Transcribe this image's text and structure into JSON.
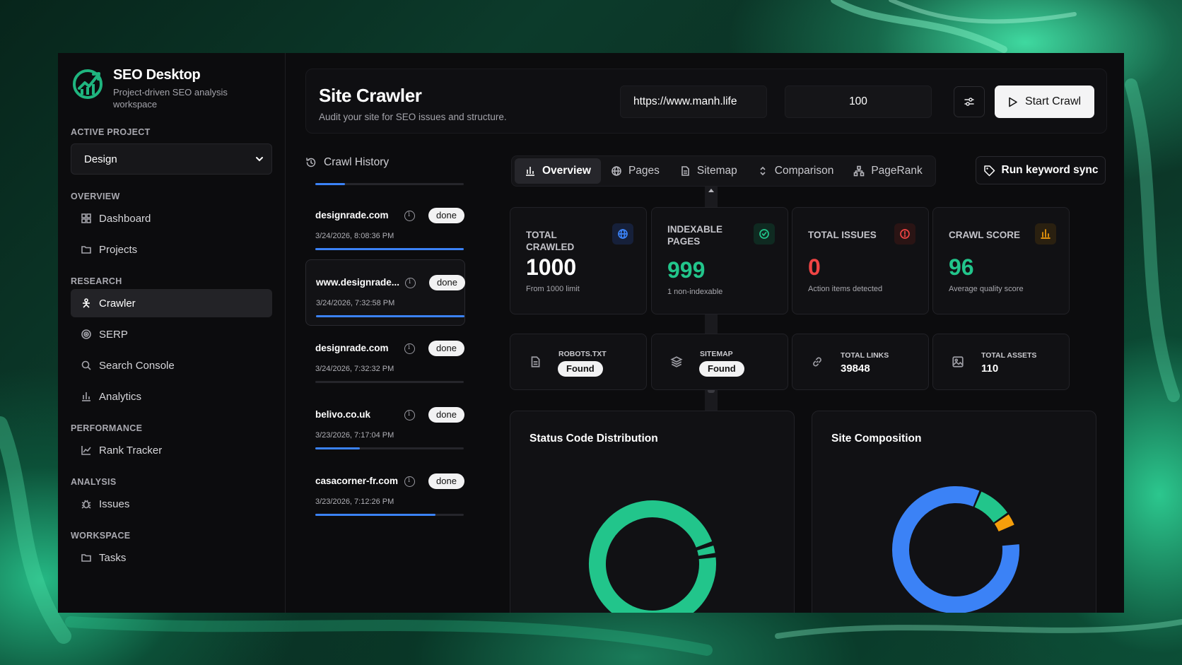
{
  "brand": {
    "title": "SEO Desktop",
    "subtitle": "Project-driven SEO analysis workspace"
  },
  "sidebar": {
    "active_project_label": "ACTIVE PROJECT",
    "project_value": "Design",
    "groups": [
      {
        "label": "OVERVIEW",
        "items": [
          {
            "label": "Dashboard",
            "icon": "grid-icon"
          },
          {
            "label": "Projects",
            "icon": "folder-icon"
          }
        ]
      },
      {
        "label": "RESEARCH",
        "items": [
          {
            "label": "Crawler",
            "icon": "crawler-icon",
            "active": true
          },
          {
            "label": "SERP",
            "icon": "target-icon"
          },
          {
            "label": "Search Console",
            "icon": "search-icon"
          },
          {
            "label": "Analytics",
            "icon": "bar-chart-icon"
          }
        ]
      },
      {
        "label": "PERFORMANCE",
        "items": [
          {
            "label": "Rank Tracker",
            "icon": "line-chart-icon"
          }
        ]
      },
      {
        "label": "ANALYSIS",
        "items": [
          {
            "label": "Issues",
            "icon": "bug-icon"
          }
        ]
      },
      {
        "label": "WORKSPACE",
        "items": [
          {
            "label": "Tasks",
            "icon": "folder-icon"
          }
        ]
      }
    ]
  },
  "header": {
    "title": "Site Crawler",
    "subtitle": "Audit your site for SEO issues and structure.",
    "url_value": "https://www.manh.life",
    "limit_value": "100",
    "start_label": "Start Crawl"
  },
  "history": {
    "title": "Crawl History",
    "items": [
      {
        "site": "",
        "date": "",
        "status": "",
        "progress": 0.2,
        "partial": true
      },
      {
        "site": "designrade.com",
        "date": "3/24/2026, 8:08:36 PM",
        "status": "done",
        "progress": 1.0
      },
      {
        "site": "www.designrade...",
        "date": "3/24/2026, 7:32:58 PM",
        "status": "done",
        "progress": 1.0,
        "selected": true
      },
      {
        "site": "designrade.com",
        "date": "3/24/2026, 7:32:32 PM",
        "status": "done",
        "progress": 0.0
      },
      {
        "site": "belivo.co.uk",
        "date": "3/23/2026, 7:17:04 PM",
        "status": "done",
        "progress": 0.3
      },
      {
        "site": "casacorner-fr.com",
        "date": "3/23/2026, 7:12:26 PM",
        "status": "done",
        "progress": 0.81
      }
    ]
  },
  "tabs": [
    {
      "label": "Overview",
      "icon": "bar-chart-icon",
      "active": true
    },
    {
      "label": "Pages",
      "icon": "globe-icon"
    },
    {
      "label": "Sitemap",
      "icon": "file-icon"
    },
    {
      "label": "Comparison",
      "icon": "chevrons-up-down-icon"
    },
    {
      "label": "PageRank",
      "icon": "network-icon"
    }
  ],
  "keyword_button": "Run keyword sync",
  "stats": [
    {
      "label": "TOTAL CRAWLED",
      "value": "1000",
      "note": "From 1000 limit",
      "color": "#ffffff",
      "icon_color": "#3b82f6",
      "icon_bg": "#16203a",
      "icon": "globe-icon"
    },
    {
      "label": "INDEXABLE PAGES",
      "value": "999",
      "note": "1 non-indexable",
      "color": "#22c58b",
      "icon_color": "#22c58b",
      "icon_bg": "#0f2a21",
      "icon": "check-circle-icon"
    },
    {
      "label": "TOTAL ISSUES",
      "value": "0",
      "note": "Action items detected",
      "color": "#ef4444",
      "icon_color": "#ef4444",
      "icon_bg": "#2a1414",
      "icon": "alert-circle-icon"
    },
    {
      "label": "CRAWL SCORE",
      "value": "96",
      "note": "Average quality score",
      "color": "#22c58b",
      "icon_color": "#f59e0b",
      "icon_bg": "#2a2010",
      "icon": "bar-chart-icon"
    }
  ],
  "mini": [
    {
      "label": "ROBOTS.TXT",
      "badge": "Found",
      "icon": "file-icon"
    },
    {
      "label": "SITEMAP",
      "badge": "Found",
      "icon": "layers-icon"
    },
    {
      "label": "TOTAL LINKS",
      "value": "39848",
      "icon": "link-icon"
    },
    {
      "label": "TOTAL ASSETS",
      "value": "110",
      "icon": "image-icon"
    }
  ],
  "charts": {
    "status": {
      "title": "Status Code Distribution"
    },
    "composition": {
      "title": "Site Composition"
    }
  },
  "chart_data": [
    {
      "type": "pie",
      "title": "Status Code Distribution",
      "slices": [
        {
          "value": 0.97,
          "color": "#22c58b"
        },
        {
          "value": 0.03,
          "color": "#22c58b"
        }
      ]
    },
    {
      "type": "pie",
      "title": "Site Composition",
      "slices": [
        {
          "value": 0.83,
          "color": "#3b82f6"
        },
        {
          "value": 0.09,
          "color": "#22c58b"
        },
        {
          "value": 0.035,
          "color": "#f59e0b"
        }
      ]
    }
  ]
}
